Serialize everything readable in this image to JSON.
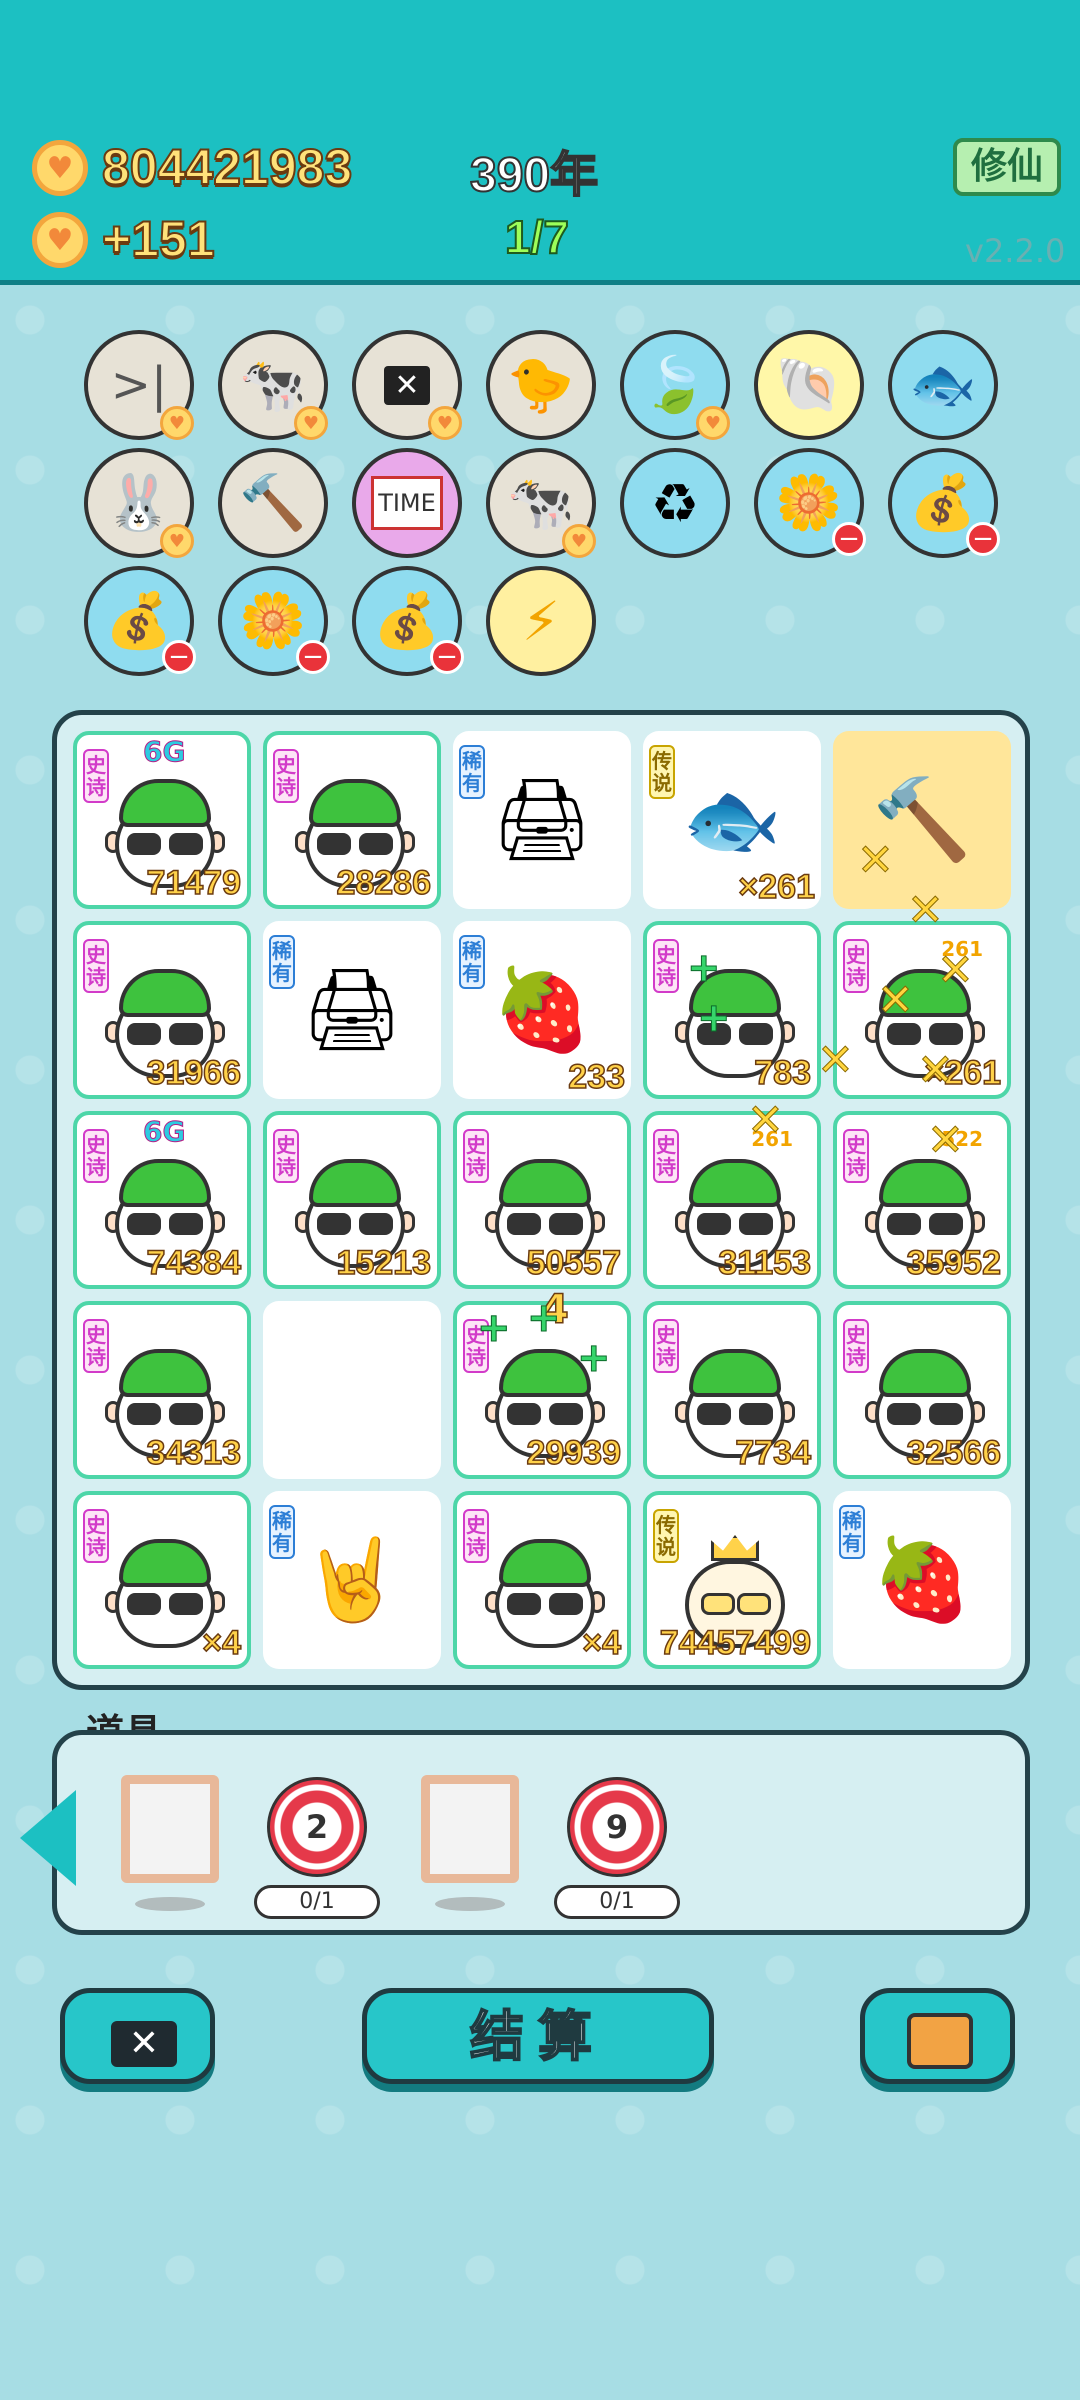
{
  "header": {
    "coins": "804421983",
    "coins_rate": "+151",
    "year": "390年",
    "ratio": "1/7",
    "xiuxian_button": "修仙",
    "version": "v2.2.0"
  },
  "board": {
    "cells": [
      {
        "tag": "史诗",
        "value": "71479",
        "badge": "6G"
      },
      {
        "tag": "史诗",
        "value": "28286"
      },
      {
        "tag": "稀有",
        "item": "printer-icon"
      },
      {
        "tag": "传说",
        "item": "koi-fish-icon",
        "value": "×261"
      },
      {
        "item": "hammer-icon"
      },
      {
        "tag": "史诗",
        "value": "31966"
      },
      {
        "tag": "稀有",
        "item": "printer-icon"
      },
      {
        "tag": "稀有",
        "item": "lychee-icon",
        "value": "233"
      },
      {
        "tag": "史诗",
        "value": "783"
      },
      {
        "tag": "史诗",
        "value": "×261",
        "badge_coin": "261"
      },
      {
        "tag": "史诗",
        "value": "74384",
        "badge": "6G"
      },
      {
        "tag": "史诗",
        "value": "15213"
      },
      {
        "tag": "史诗",
        "value": "50557"
      },
      {
        "tag": "史诗",
        "value": "31153",
        "badge_coin": "261"
      },
      {
        "tag": "史诗",
        "value": "35952",
        "badge_coin": "522"
      },
      {
        "tag": "史诗",
        "value": "34313"
      },
      {},
      {
        "tag": "史诗",
        "value": "29939",
        "coin_count": "4"
      },
      {
        "tag": "史诗",
        "value": "7734"
      },
      {
        "tag": "史诗",
        "value": "32566"
      },
      {
        "tag": "史诗",
        "value": "×4"
      },
      {
        "tag": "稀有",
        "item": "rock-hand-icon"
      },
      {
        "tag": "史诗",
        "value": "×4"
      },
      {
        "tag": "传说",
        "value": "74457499"
      },
      {
        "tag": "稀有",
        "item": "lychee-icon"
      }
    ]
  },
  "props": {
    "label": "道具",
    "items": [
      {
        "type": "frame"
      },
      {
        "type": "target",
        "count": "2",
        "usage": "0/1"
      },
      {
        "type": "frame"
      },
      {
        "type": "target",
        "count": "9",
        "usage": "0/1"
      }
    ]
  },
  "actions": {
    "settle": "结算"
  },
  "colors": {
    "header_bg": "#1cc0c2",
    "epic_tag": "#d23bc9",
    "rare_tag": "#2c7ed6",
    "legend_tag": "#c8a400",
    "value_text": "#ffd24a"
  }
}
